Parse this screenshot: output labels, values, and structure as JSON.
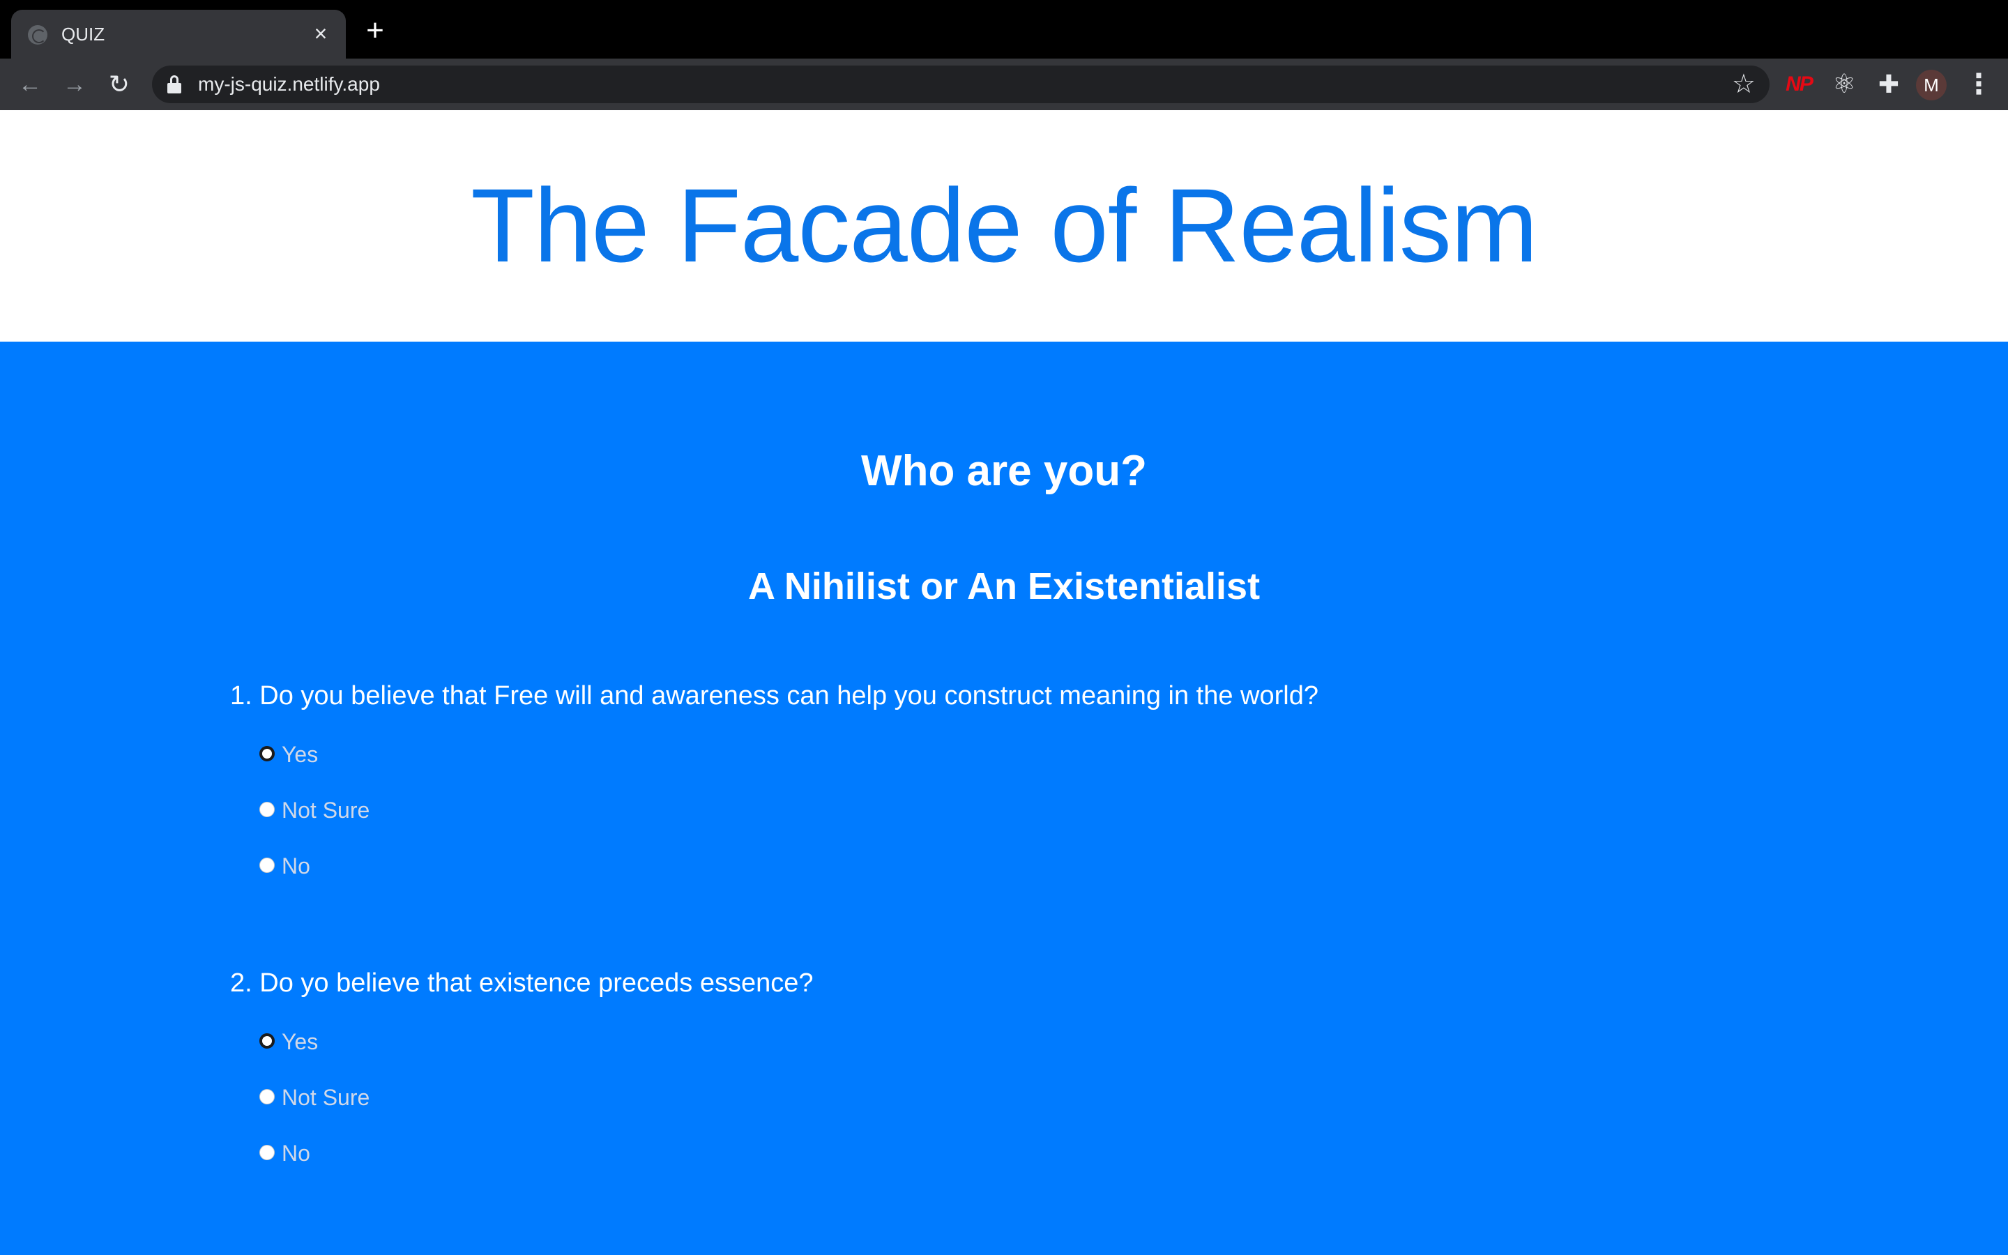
{
  "browser": {
    "tab_title": "QUIZ",
    "tab_close": "×",
    "new_tab": "+",
    "url": "my-js-quiz.netlify.app",
    "avatar_initial": "M",
    "extension_np_label": "NP"
  },
  "page": {
    "title": "The Facade of Realism",
    "heading": "Who are you?",
    "subheading": "A Nihilist or An Existentialist",
    "questions": [
      {
        "text": "1. Do you believe that Free will and awareness can help you construct meaning in the world?",
        "options": [
          "Yes",
          "Not Sure",
          "No"
        ],
        "selected": "Yes"
      },
      {
        "text": "2. Do yo believe that existence preceds essence?",
        "options": [
          "Yes",
          "Not Sure",
          "No"
        ],
        "selected": "Yes"
      }
    ]
  },
  "colors": {
    "brand_blue": "#007bff",
    "title_blue": "#0a75e9",
    "chrome_dark": "#35363a",
    "np_red": "#e50914"
  }
}
